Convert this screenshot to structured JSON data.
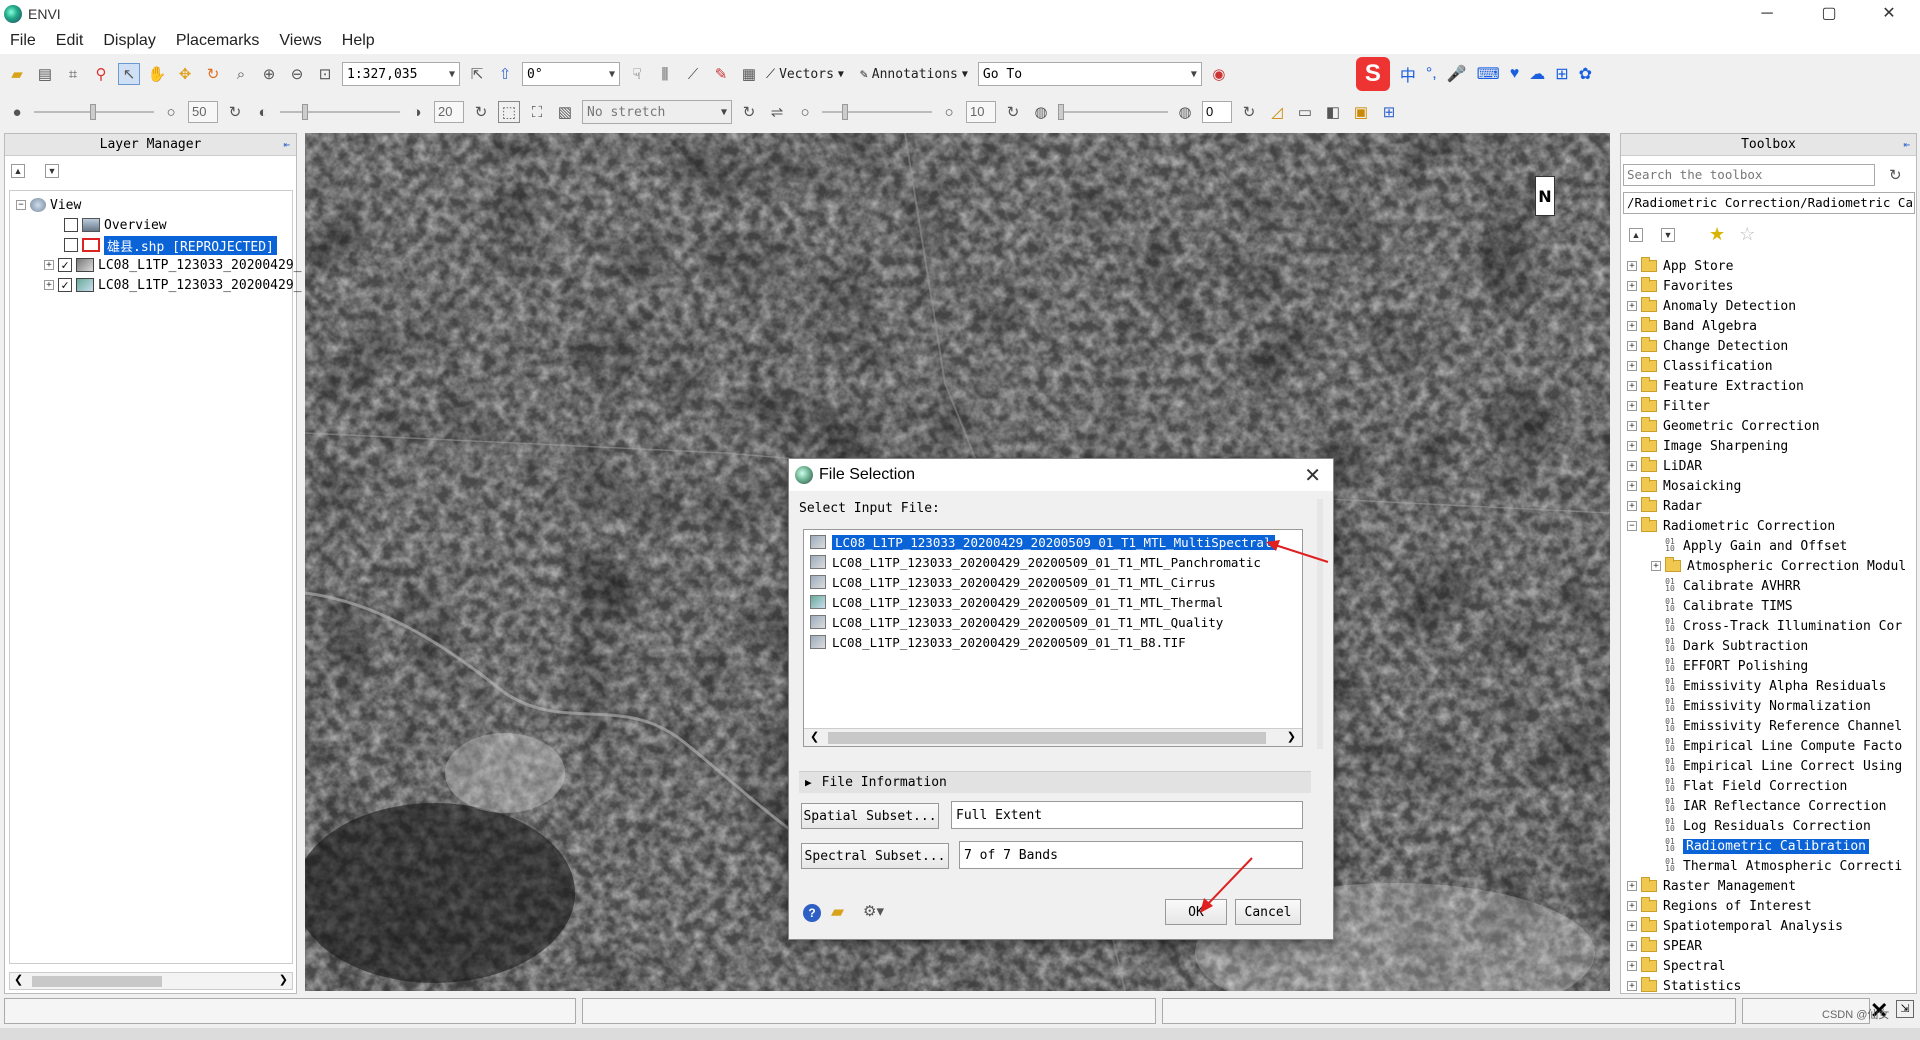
{
  "window": {
    "title": "ENVI",
    "min": "─",
    "max": "▢",
    "close": "✕"
  },
  "menu": [
    "File",
    "Edit",
    "Display",
    "Placemarks",
    "Views",
    "Help"
  ],
  "toolbar": {
    "scale": "1:327,035",
    "rotation": "0°",
    "vectors": "Vectors",
    "annotations": "Annotations",
    "goto": "Go To",
    "brightness": "50",
    "contrast": "20",
    "stretch": "No stretch",
    "sharpen": "10",
    "transparency": "0"
  },
  "ime": {
    "logo": "S",
    "items": [
      "中",
      "°,",
      "🎤",
      "⌨",
      "♥",
      "☁",
      "⊞",
      "✿"
    ]
  },
  "layer_manager": {
    "title": "Layer Manager",
    "view_label": "View",
    "items": [
      {
        "label": "Overview",
        "checked": false
      },
      {
        "label": "雄县.shp [REPROJECTED]",
        "checked": false,
        "selected": true
      },
      {
        "label": "LC08_L1TP_123033_20200429_",
        "checked": true
      },
      {
        "label": "LC08_L1TP_123033_20200429_",
        "checked": true
      }
    ]
  },
  "map": {
    "north_label": "N"
  },
  "toolbox": {
    "title": "Toolbox",
    "search_placeholder": "Search the toolbox",
    "path": "/Radiometric Correction/Radiometric Ca",
    "folders_top": [
      "App Store",
      "Favorites",
      "Anomaly Detection",
      "Band Algebra",
      "Change Detection",
      "Classification",
      "Feature Extraction",
      "Filter",
      "Geometric Correction",
      "Image Sharpening",
      "LiDAR",
      "Mosaicking",
      "Radar",
      "Radiometric Correction"
    ],
    "radiometric_tools": [
      "Apply Gain and Offset",
      "Atmospheric Correction Modul",
      "Calibrate AVHRR",
      "Calibrate TIMS",
      "Cross-Track Illumination Cor",
      "Dark Subtraction",
      "EFFORT Polishing",
      "Emissivity Alpha Residuals",
      "Emissivity Normalization",
      "Emissivity Reference Channel",
      "Empirical Line Compute Facto",
      "Empirical Line Correct Using",
      "Flat Field Correction",
      "IAR Reflectance Correction",
      "Log Residuals Correction",
      "Radiometric Calibration",
      "Thermal Atmospheric Correcti"
    ],
    "selected_tool": "Radiometric Calibration",
    "folders_bottom": [
      "Raster Management",
      "Regions of Interest",
      "Spatiotemporal Analysis",
      "SPEAR",
      "Spectral",
      "Statistics"
    ]
  },
  "dialog": {
    "title": "File Selection",
    "select_label": "Select Input File:",
    "files": [
      "LC08_L1TP_123033_20200429_20200509_01_T1_MTL_MultiSpectral",
      "LC08_L1TP_123033_20200429_20200509_01_T1_MTL_Panchromatic",
      "LC08_L1TP_123033_20200429_20200509_01_T1_MTL_Cirrus",
      "LC08_L1TP_123033_20200429_20200509_01_T1_MTL_Thermal",
      "LC08_L1TP_123033_20200429_20200509_01_T1_MTL_Quality",
      "LC08_L1TP_123033_20200429_20200509_01_T1_B8.TIF"
    ],
    "file_info": "File Information",
    "spatial_btn": "Spatial Subset...",
    "spatial_val": "Full Extent",
    "spectral_btn": "Spectral Subset...",
    "spectral_val": "7 of 7 Bands",
    "ok": "OK",
    "cancel": "Cancel",
    "close": "✕"
  },
  "status": {
    "watermark": "CSDN @仙女"
  }
}
